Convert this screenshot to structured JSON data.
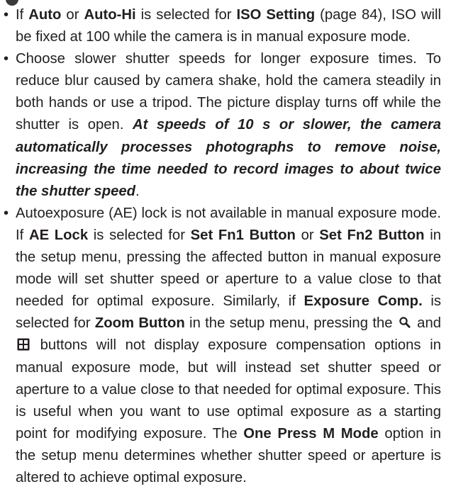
{
  "notes": {
    "iso": {
      "t0": "If ",
      "auto": "Auto",
      "t1": " or ",
      "auto_hi": "Auto-Hi",
      "t2": " is selected for ",
      "iso_setting": "ISO Setting",
      "t3": " (page 84), ISO will be fixed at 100 while the camera is in manual exposure mode."
    },
    "shutter": {
      "t0": "Choose slower shutter speeds for longer exposure times. To reduce blur caused by camera shake, hold the camera steadily in both hands or use a tripod. The picture display turns off while the shutter is open. ",
      "emph": "At speeds of 10 s or slower, the camera automatically processes photographs to remove noise, increasing the time needed to record images to about twice the shutter speed",
      "t1": "."
    },
    "ae": {
      "t0": "Autoexposure (AE) lock is not available in manual exposure mode. If ",
      "ae_lock": "AE Lock",
      "t1": " is selected for ",
      "fn1": "Set Fn1 Button",
      "t2": " or ",
      "fn2": "Set Fn2 Button",
      "t3": " in the setup menu, pressing the affected button in manual exposure mode will set shutter speed or aperture to a value close to that needed for optimal exposure. Similarly, if ",
      "exp_comp": "Exposure Comp.",
      "t4": " is selected for ",
      "zoom_button": "Zoom Button",
      "t5": " in the setup menu, pressing the ",
      "t6": " and ",
      "t7": " buttons will not display exposure compensation options in manual exposure mode, but will instead set shutter speed or aperture to a value close to that needed for optimal exposure. This is useful when you want to use optimal exposure as a starting point for modifying exposure. The ",
      "one_press": "One Press M Mode",
      "t8": " option in the setup menu determines whether shutter speed or aperture is altered to achieve optimal exposure."
    }
  },
  "icons": {
    "zoom_in": "zoom-in-magnifier-icon",
    "thumbnail": "thumbnail-grid-icon"
  }
}
